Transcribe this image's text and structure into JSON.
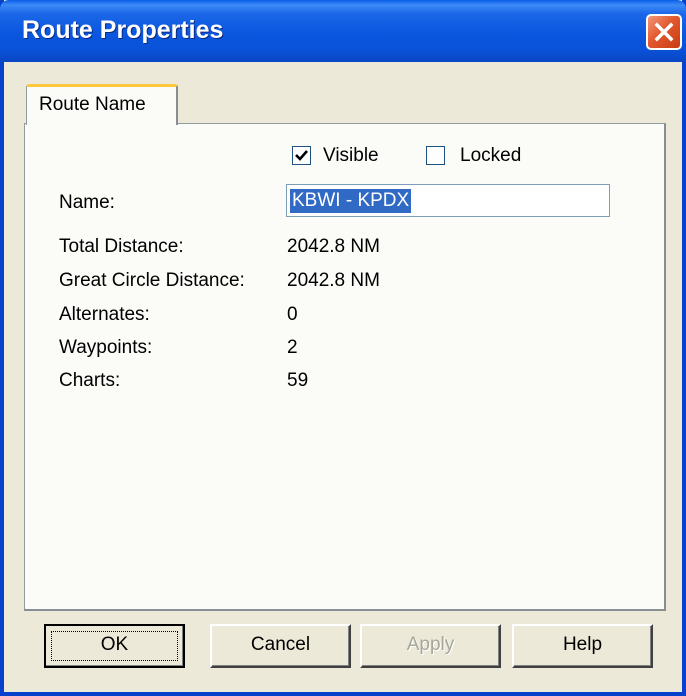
{
  "window": {
    "title": "Route Properties"
  },
  "tabs": [
    {
      "label": "Route Name"
    }
  ],
  "options": {
    "visible_label": "Visible",
    "visible_checked": true,
    "locked_label": "Locked",
    "locked_checked": false
  },
  "name_field": {
    "label": "Name:",
    "value": "KBWI - KPDX"
  },
  "stats": [
    {
      "label": "Total Distance:",
      "value": "2042.8 NM"
    },
    {
      "label": "Great Circle Distance:",
      "value": "2042.8 NM"
    },
    {
      "label": "Alternates:",
      "value": "0"
    },
    {
      "label": "Waypoints:",
      "value": "2"
    },
    {
      "label": "Charts:",
      "value": "59"
    }
  ],
  "buttons": {
    "ok": "OK",
    "cancel": "Cancel",
    "apply": "Apply",
    "help": "Help"
  },
  "colors": {
    "titlebar": "#0a56de",
    "selection": "#316ac5",
    "close": "#e2582e"
  }
}
